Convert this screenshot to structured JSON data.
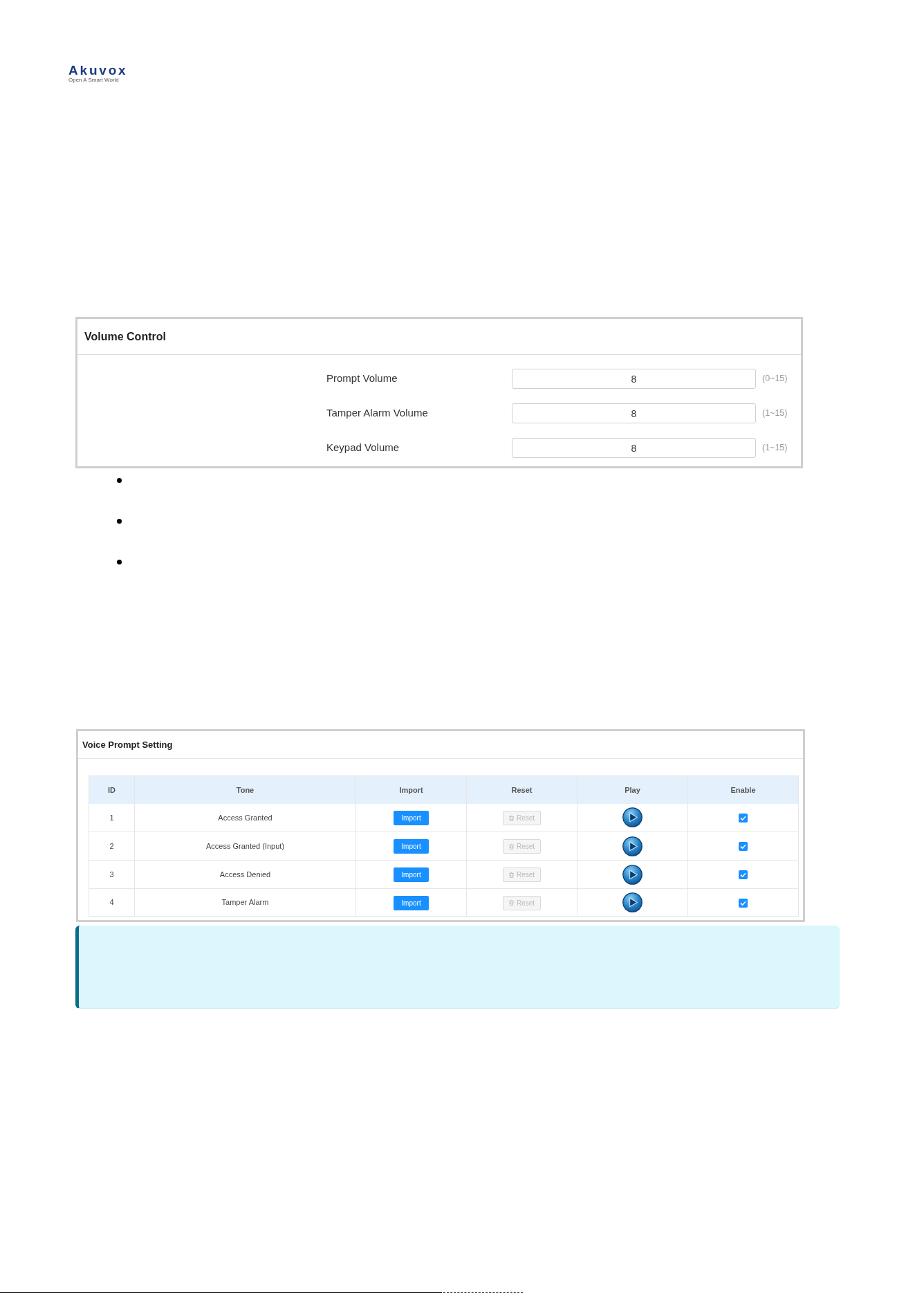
{
  "logo": {
    "wordmark": "Akuvox",
    "tagline": "Open A Smart World"
  },
  "volume_control": {
    "title": "Volume Control",
    "fields": [
      {
        "label": "Prompt Volume",
        "value": "8",
        "range": "(0~15)"
      },
      {
        "label": "Tamper Alarm Volume",
        "value": "8",
        "range": "(1~15)"
      },
      {
        "label": "Keypad Volume",
        "value": "8",
        "range": "(1~15)"
      }
    ]
  },
  "voice_prompt_setting": {
    "title": "Voice Prompt Setting",
    "columns": [
      "ID",
      "Tone",
      "Import",
      "Reset",
      "Play",
      "Enable"
    ],
    "rows": [
      {
        "id": "1",
        "tone": "Access Granted",
        "import": "Import",
        "reset": {
          "label": "Reset",
          "disabled": true
        },
        "enabled": true
      },
      {
        "id": "2",
        "tone": "Access Granted (Input)",
        "import": "Import",
        "reset": {
          "label": "Reset",
          "disabled": true
        },
        "enabled": true
      },
      {
        "id": "3",
        "tone": "Access Denied",
        "import": "Import",
        "reset": {
          "label": "Reset",
          "disabled": true
        },
        "enabled": true
      },
      {
        "id": "4",
        "tone": "Tamper Alarm",
        "import": "Import",
        "reset": {
          "label": "Reset",
          "disabled": true
        },
        "enabled": true
      }
    ]
  }
}
